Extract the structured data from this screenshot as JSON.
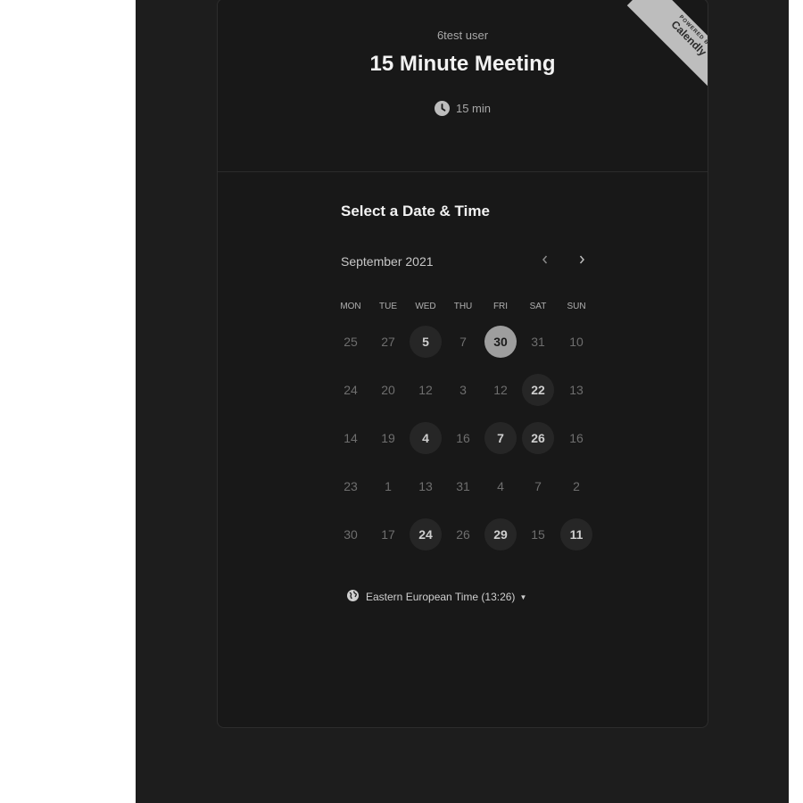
{
  "event": {
    "owner": "6test user",
    "title": "15 Minute Meeting",
    "duration": "15 min"
  },
  "branding": {
    "powered_by": "POWERED BY",
    "brand": "Calendly"
  },
  "calendar": {
    "section_title": "Select a Date & Time",
    "month_label": "September 2021",
    "weekdays": [
      "MON",
      "TUE",
      "WED",
      "THU",
      "FRI",
      "SAT",
      "SUN"
    ],
    "weeks": [
      [
        {
          "d": "25",
          "s": "plain"
        },
        {
          "d": "27",
          "s": "plain"
        },
        {
          "d": "5",
          "s": "available"
        },
        {
          "d": "7",
          "s": "plain"
        },
        {
          "d": "30",
          "s": "selected"
        },
        {
          "d": "31",
          "s": "plain"
        },
        {
          "d": "10",
          "s": "plain"
        }
      ],
      [
        {
          "d": "24",
          "s": "plain"
        },
        {
          "d": "20",
          "s": "plain"
        },
        {
          "d": "12",
          "s": "plain"
        },
        {
          "d": "3",
          "s": "plain"
        },
        {
          "d": "12",
          "s": "plain"
        },
        {
          "d": "22",
          "s": "available"
        },
        {
          "d": "13",
          "s": "plain"
        }
      ],
      [
        {
          "d": "14",
          "s": "plain"
        },
        {
          "d": "19",
          "s": "plain"
        },
        {
          "d": "4",
          "s": "available"
        },
        {
          "d": "16",
          "s": "plain"
        },
        {
          "d": "7",
          "s": "available"
        },
        {
          "d": "26",
          "s": "available"
        },
        {
          "d": "16",
          "s": "plain"
        }
      ],
      [
        {
          "d": "23",
          "s": "plain"
        },
        {
          "d": "1",
          "s": "plain"
        },
        {
          "d": "13",
          "s": "plain"
        },
        {
          "d": "31",
          "s": "plain"
        },
        {
          "d": "4",
          "s": "plain"
        },
        {
          "d": "7",
          "s": "plain"
        },
        {
          "d": "2",
          "s": "plain"
        }
      ],
      [
        {
          "d": "30",
          "s": "plain"
        },
        {
          "d": "17",
          "s": "plain"
        },
        {
          "d": "24",
          "s": "available"
        },
        {
          "d": "26",
          "s": "plain"
        },
        {
          "d": "29",
          "s": "available"
        },
        {
          "d": "15",
          "s": "plain"
        },
        {
          "d": "11",
          "s": "available"
        }
      ]
    ]
  },
  "timezone": {
    "label": "Eastern European Time (13:26)"
  },
  "colors": {
    "page_bg": "#1d1d1d",
    "card_bg": "#181818",
    "available_day_bg": "#262626",
    "selected_day_bg": "#9e9e9e",
    "ribbon_bg": "#bdbdbd"
  },
  "icons": {
    "duration": "clock-icon",
    "timezone": "globe-icon",
    "prev_month": "chevron-left-icon",
    "next_month": "chevron-right-icon",
    "timezone_dropdown": "caret-down-icon"
  }
}
